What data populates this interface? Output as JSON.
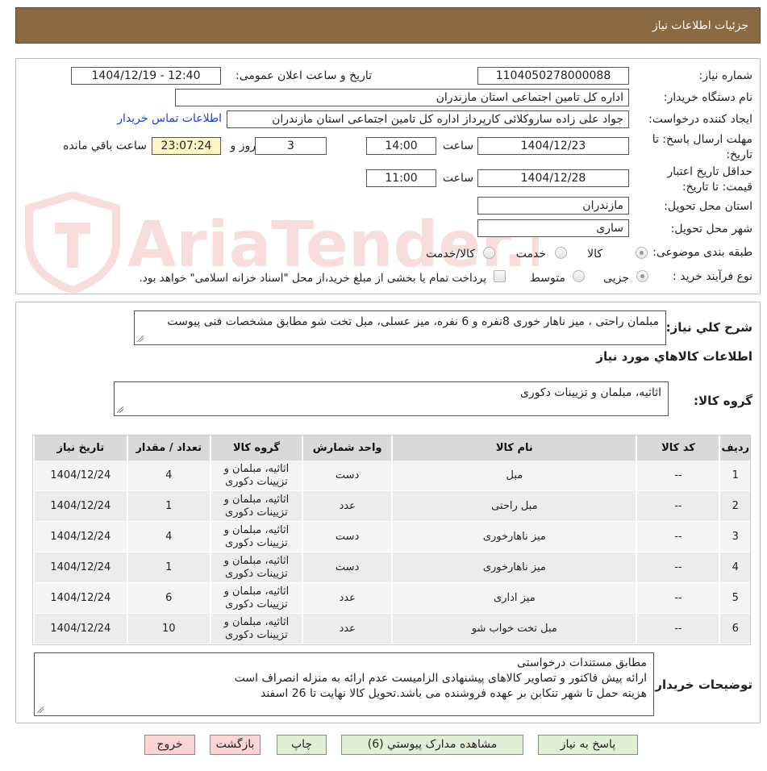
{
  "header": {
    "title": "جزئیات اطلاعات نیاز"
  },
  "details": {
    "need_number_label": "شماره نیاز:",
    "need_number": "1104050278000088",
    "announce_label": "تاریخ و ساعت اعلان عمومی:",
    "announce_value": "1404/12/19 - 12:40",
    "buyer_org_label": "نام دستگاه خریدار:",
    "buyer_org": "اداره کل تامین اجتماعی استان مازندران",
    "creator_label": "ایجاد کننده درخواست:",
    "creator": "جواد علی زاده ساروکلائی کارپرداز اداره کل تامین اجتماعی استان مازندران",
    "contact_link": "اطلاعات تماس خریدار",
    "deadline_label_1": "مهلت ارسال پاسخ: تا",
    "deadline_label_2": "تاریخ:",
    "deadline_date": "1404/12/23",
    "time_label": "ساعت",
    "deadline_time": "14:00",
    "days_value": "3",
    "days_label": "روز و",
    "remaining_time": "23:07:24",
    "remaining_label": "ساعت باقي مانده",
    "validity_label_1": "حداقل تاریخ اعتبار",
    "validity_label_2": "قیمت: تا تاریخ:",
    "validity_date": "1404/12/28",
    "validity_time": "11:00",
    "province_label": "استان محل تحویل:",
    "province": "مازندران",
    "city_label": "شهر محل تحویل:",
    "city": "ساری",
    "category_label": "طبقه بندی موضوعی:",
    "category_options": [
      "کالا",
      "خدمت",
      "کالا/خدمت"
    ],
    "process_label": "نوع فرآیند خرید :",
    "process_options": [
      "جزیی",
      "متوسط"
    ],
    "treasury_note": "پرداخت تمام یا بخشی از مبلغ خرید،از محل \"اسناد خزانه اسلامی\" خواهد بود."
  },
  "summary": {
    "label": "شرح کلي نياز:",
    "text": "مبلمان راحتی ، میز ناهار خوری 8نفره و 6 نفره، میز عسلی، مبل تخت شو مطابق مشخصات فنی پیوست",
    "goods_info_title": "اطلاعات کالاهاي مورد نياز",
    "goods_group_label": "گروه کالا:",
    "goods_group": "اثاثیه، مبلمان و تزیینات دکوری"
  },
  "table": {
    "headers": [
      "رديف",
      "کد کالا",
      "نام کالا",
      "واحد شمارش",
      "گروه کالا",
      "تعداد / مقدار",
      "تاريخ نياز"
    ],
    "rows": [
      [
        "1",
        "--",
        "مبل",
        "دست",
        "اثاثیه، مبلمان و تزیینات دکوری",
        "4",
        "1404/12/24"
      ],
      [
        "2",
        "--",
        "مبل راحتی",
        "عدد",
        "اثاثیه، مبلمان و تزیینات دکوری",
        "1",
        "1404/12/24"
      ],
      [
        "3",
        "--",
        "میز ناهارخوری",
        "دست",
        "اثاثیه، مبلمان و تزیینات دکوری",
        "4",
        "1404/12/24"
      ],
      [
        "4",
        "--",
        "میز ناهارخوری",
        "دست",
        "اثاثیه، مبلمان و تزیینات دکوری",
        "1",
        "1404/12/24"
      ],
      [
        "5",
        "--",
        "میز اداری",
        "عدد",
        "اثاثیه، مبلمان و تزیینات دکوری",
        "6",
        "1404/12/24"
      ],
      [
        "6",
        "--",
        "مبل تخت خواب شو",
        "عدد",
        "اثاثیه، مبلمان و تزیینات دکوری",
        "10",
        "1404/12/24"
      ]
    ]
  },
  "buyer_notes": {
    "label": "توضیحات خریدار:",
    "lines": [
      "مطابق مستندات درخواستی",
      "ارائه پیش فاکتور و تصاویر کالاهای پیشنهادی الزامیست عدم ارائه به منزله انصراف است",
      "هزینه حمل تا شهر تنکابن بر عهده فروشنده می باشد.تحویل کالا نهایت تا 26 اسفند"
    ]
  },
  "buttons": {
    "reply": "پاسخ به نياز",
    "attachments": "مشاهده مدارک پيوستي (6)",
    "print": "چاپ",
    "back": "بازگشت",
    "exit": "خروج"
  },
  "watermark": {
    "text": "AriaTender.neT"
  },
  "colors": {
    "header_bg": "#8a6a43",
    "link": "#1c3fd6",
    "remaining_bg": "#fdf6c4",
    "button_green": "#dff0d4",
    "button_red": "#fbd4d4"
  }
}
